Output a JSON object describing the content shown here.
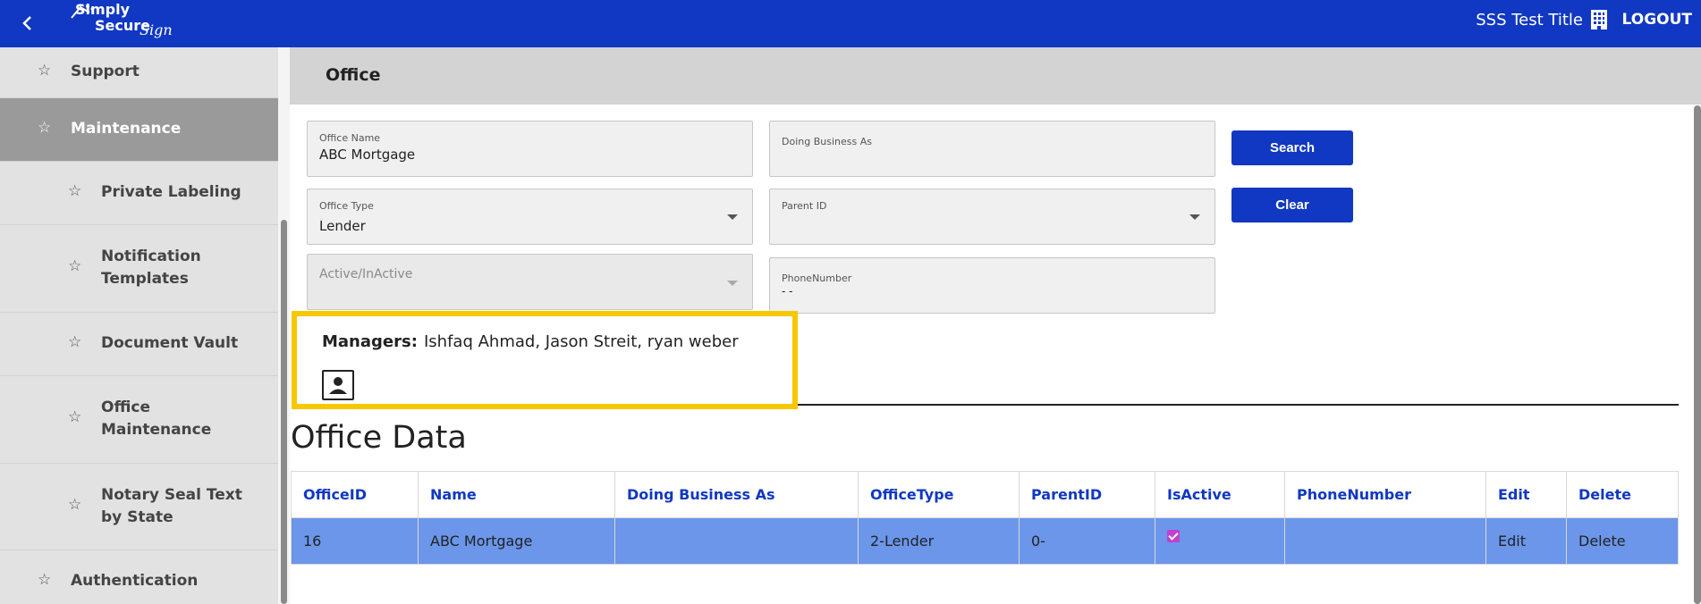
{
  "topbar": {
    "logo_line1": "Simply",
    "logo_line2": "Secure",
    "logo_sign": "Sign",
    "title": "SSS Test Title",
    "logout_label": "LOGOUT"
  },
  "sidebar": {
    "items": [
      {
        "label": "Support"
      },
      {
        "label": "Maintenance"
      },
      {
        "label": "Private Labeling"
      },
      {
        "label": "Notification Templates"
      },
      {
        "label": "Document Vault"
      },
      {
        "label": "Office Maintenance"
      },
      {
        "label": "Notary Seal Text by State"
      },
      {
        "label": "Authentication"
      }
    ]
  },
  "main": {
    "header_title": "Office",
    "fields": {
      "office_name_label": "Office Name",
      "office_name_value": "ABC Mortgage",
      "dba_label": "Doing Business As",
      "dba_value": "",
      "office_type_label": "Office Type",
      "office_type_value": "Lender",
      "parent_id_label": "Parent ID",
      "parent_id_value": "",
      "active_label": "Active/InActive",
      "phone_label": "PhoneNumber",
      "phone_value": "  -   -"
    },
    "search_label": "Search",
    "clear_label": "Clear",
    "managers_label": "Managers:",
    "managers_value": "Ishfaq Ahmad, Jason Streit, ryan weber",
    "data_title": "Office Data",
    "table": {
      "headers": [
        "OfficeID",
        "Name",
        "Doing Business As",
        "OfficeType",
        "ParentID",
        "IsActive",
        "PhoneNumber",
        "Edit",
        "Delete"
      ],
      "rows": [
        {
          "office_id": "16",
          "name": "ABC Mortgage",
          "dba": "",
          "office_type": "2-Lender",
          "parent_id": "0-",
          "is_active": true,
          "phone": "",
          "edit": "Edit",
          "delete": "Delete"
        }
      ]
    }
  },
  "colors": {
    "primary": "#1138c2",
    "highlight": "#f7c800",
    "row": "#6b96ea",
    "sidebar_active": "#9a9a9a"
  }
}
